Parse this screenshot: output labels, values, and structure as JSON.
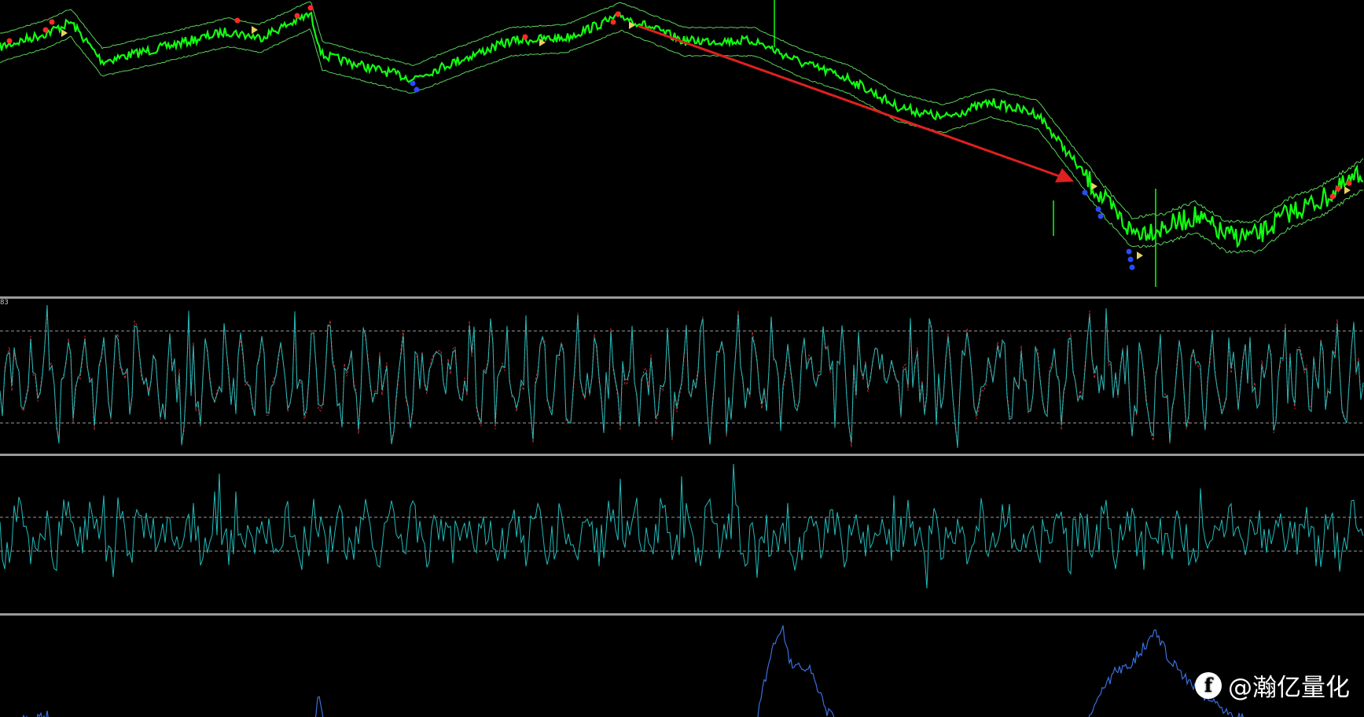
{
  "panes": {
    "price": {
      "name": "price-chart-pane"
    },
    "oscillator1": {
      "label": "83"
    },
    "oscillator2": {},
    "oscillator3": {}
  },
  "annotation": {
    "arrow_color": "#e02020"
  },
  "colors": {
    "price": "#11ff11",
    "band": "#5ad25a",
    "osc1": "#22bbbb",
    "osc1_signal": "#cc3333",
    "osc2": "#22bbbb",
    "osc3": "#3a6fe0",
    "levels": "#9a9a9a",
    "sell_marker": "#ff2a2a",
    "buy_marker": "#2a4aff"
  },
  "watermark": {
    "text": "@瀚亿量化",
    "icon": "f-logo-icon"
  }
}
